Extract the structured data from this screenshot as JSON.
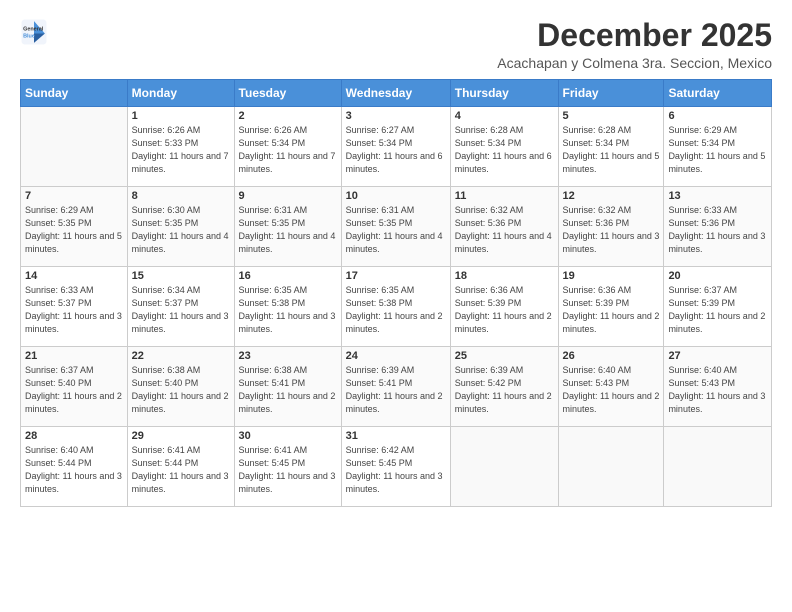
{
  "logo": {
    "line1": "General",
    "line2": "Blue"
  },
  "title": "December 2025",
  "location": "Acachapan y Colmena 3ra. Seccion, Mexico",
  "days_header": [
    "Sunday",
    "Monday",
    "Tuesday",
    "Wednesday",
    "Thursday",
    "Friday",
    "Saturday"
  ],
  "weeks": [
    [
      {
        "num": "",
        "empty": true
      },
      {
        "num": "1",
        "sunrise": "6:26 AM",
        "sunset": "5:33 PM",
        "daylight": "11 hours and 7 minutes."
      },
      {
        "num": "2",
        "sunrise": "6:26 AM",
        "sunset": "5:34 PM",
        "daylight": "11 hours and 7 minutes."
      },
      {
        "num": "3",
        "sunrise": "6:27 AM",
        "sunset": "5:34 PM",
        "daylight": "11 hours and 6 minutes."
      },
      {
        "num": "4",
        "sunrise": "6:28 AM",
        "sunset": "5:34 PM",
        "daylight": "11 hours and 6 minutes."
      },
      {
        "num": "5",
        "sunrise": "6:28 AM",
        "sunset": "5:34 PM",
        "daylight": "11 hours and 5 minutes."
      },
      {
        "num": "6",
        "sunrise": "6:29 AM",
        "sunset": "5:34 PM",
        "daylight": "11 hours and 5 minutes."
      }
    ],
    [
      {
        "num": "7",
        "sunrise": "6:29 AM",
        "sunset": "5:35 PM",
        "daylight": "11 hours and 5 minutes."
      },
      {
        "num": "8",
        "sunrise": "6:30 AM",
        "sunset": "5:35 PM",
        "daylight": "11 hours and 4 minutes."
      },
      {
        "num": "9",
        "sunrise": "6:31 AM",
        "sunset": "5:35 PM",
        "daylight": "11 hours and 4 minutes."
      },
      {
        "num": "10",
        "sunrise": "6:31 AM",
        "sunset": "5:35 PM",
        "daylight": "11 hours and 4 minutes."
      },
      {
        "num": "11",
        "sunrise": "6:32 AM",
        "sunset": "5:36 PM",
        "daylight": "11 hours and 4 minutes."
      },
      {
        "num": "12",
        "sunrise": "6:32 AM",
        "sunset": "5:36 PM",
        "daylight": "11 hours and 3 minutes."
      },
      {
        "num": "13",
        "sunrise": "6:33 AM",
        "sunset": "5:36 PM",
        "daylight": "11 hours and 3 minutes."
      }
    ],
    [
      {
        "num": "14",
        "sunrise": "6:33 AM",
        "sunset": "5:37 PM",
        "daylight": "11 hours and 3 minutes."
      },
      {
        "num": "15",
        "sunrise": "6:34 AM",
        "sunset": "5:37 PM",
        "daylight": "11 hours and 3 minutes."
      },
      {
        "num": "16",
        "sunrise": "6:35 AM",
        "sunset": "5:38 PM",
        "daylight": "11 hours and 3 minutes."
      },
      {
        "num": "17",
        "sunrise": "6:35 AM",
        "sunset": "5:38 PM",
        "daylight": "11 hours and 2 minutes."
      },
      {
        "num": "18",
        "sunrise": "6:36 AM",
        "sunset": "5:39 PM",
        "daylight": "11 hours and 2 minutes."
      },
      {
        "num": "19",
        "sunrise": "6:36 AM",
        "sunset": "5:39 PM",
        "daylight": "11 hours and 2 minutes."
      },
      {
        "num": "20",
        "sunrise": "6:37 AM",
        "sunset": "5:39 PM",
        "daylight": "11 hours and 2 minutes."
      }
    ],
    [
      {
        "num": "21",
        "sunrise": "6:37 AM",
        "sunset": "5:40 PM",
        "daylight": "11 hours and 2 minutes."
      },
      {
        "num": "22",
        "sunrise": "6:38 AM",
        "sunset": "5:40 PM",
        "daylight": "11 hours and 2 minutes."
      },
      {
        "num": "23",
        "sunrise": "6:38 AM",
        "sunset": "5:41 PM",
        "daylight": "11 hours and 2 minutes."
      },
      {
        "num": "24",
        "sunrise": "6:39 AM",
        "sunset": "5:41 PM",
        "daylight": "11 hours and 2 minutes."
      },
      {
        "num": "25",
        "sunrise": "6:39 AM",
        "sunset": "5:42 PM",
        "daylight": "11 hours and 2 minutes."
      },
      {
        "num": "26",
        "sunrise": "6:40 AM",
        "sunset": "5:43 PM",
        "daylight": "11 hours and 2 minutes."
      },
      {
        "num": "27",
        "sunrise": "6:40 AM",
        "sunset": "5:43 PM",
        "daylight": "11 hours and 3 minutes."
      }
    ],
    [
      {
        "num": "28",
        "sunrise": "6:40 AM",
        "sunset": "5:44 PM",
        "daylight": "11 hours and 3 minutes."
      },
      {
        "num": "29",
        "sunrise": "6:41 AM",
        "sunset": "5:44 PM",
        "daylight": "11 hours and 3 minutes."
      },
      {
        "num": "30",
        "sunrise": "6:41 AM",
        "sunset": "5:45 PM",
        "daylight": "11 hours and 3 minutes."
      },
      {
        "num": "31",
        "sunrise": "6:42 AM",
        "sunset": "5:45 PM",
        "daylight": "11 hours and 3 minutes."
      },
      {
        "num": "",
        "empty": true
      },
      {
        "num": "",
        "empty": true
      },
      {
        "num": "",
        "empty": true
      }
    ]
  ],
  "labels": {
    "sunrise": "Sunrise:",
    "sunset": "Sunset:",
    "daylight": "Daylight:"
  }
}
